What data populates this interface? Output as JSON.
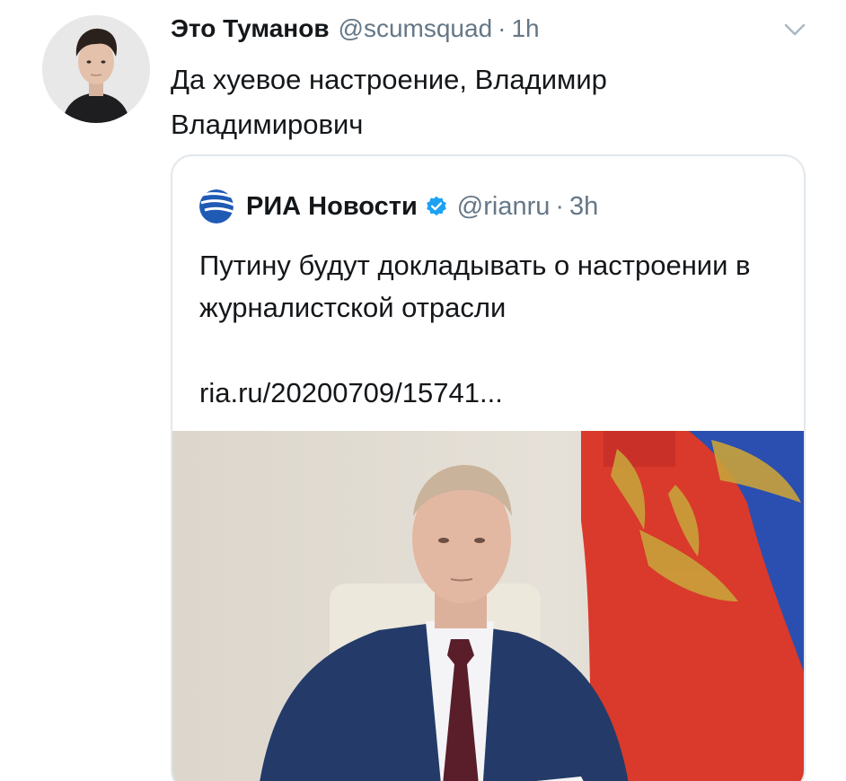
{
  "tweet": {
    "author_name": "Это Туманов",
    "author_handle": "@scumsquad",
    "separator": "·",
    "time": "1h",
    "text": "Да хуевое настроение, Владимир Владимирович",
    "caret_icon": "chevron-down-icon"
  },
  "quote": {
    "author_name": "РИА Новости",
    "author_handle": "@rianru",
    "separator": "·",
    "time": "3h",
    "verified": true,
    "text": "Путину будут докладывать о настроении в журналистской отрасли",
    "link": "ria.ru/20200709/15741...",
    "logo_icon": "ria-logo-icon",
    "verified_icon": "verified-badge-icon",
    "photo_icon": "news-photo"
  },
  "colors": {
    "text_primary": "#14171a",
    "text_secondary": "#657786",
    "border": "#e1e8ed",
    "verified_blue": "#1da1f2",
    "ria_blue": "#1f5ab4"
  }
}
